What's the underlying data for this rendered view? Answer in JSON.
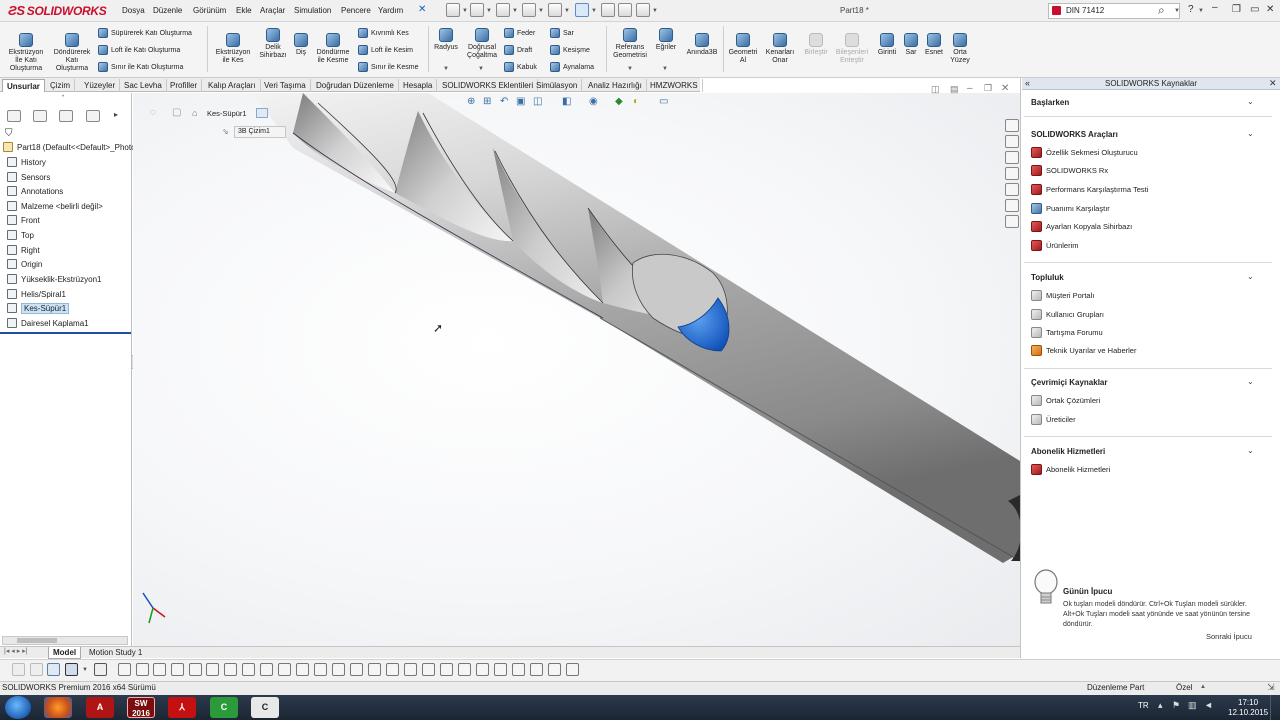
{
  "app": {
    "logo_text": "SOLIDWORKS",
    "doc_title": "Part18 *",
    "search_value": "DIN 71412"
  },
  "menu": [
    "Dosya",
    "Düzenle",
    "Görünüm",
    "Ekle",
    "Araçlar",
    "Simulation",
    "Pencere",
    "Yardım"
  ],
  "command_manager": {
    "big_buttons": [
      {
        "label": "Ekstrüzyon\nİle Katı\nOluşturma"
      },
      {
        "label": "Döndürerek\nKatı\nOluşturma"
      },
      {
        "label": "Ekstrüzyon\nile Kes"
      },
      {
        "label": "Delik\nSihirbazı"
      },
      {
        "label": "Diş"
      },
      {
        "label": "Döndürme\nile Kesme"
      },
      {
        "label": "Radyus"
      },
      {
        "label": "Doğrusal\nÇoğaltma"
      },
      {
        "label": "Referans\nGeometrisi"
      },
      {
        "label": "Eğriler"
      },
      {
        "label": "Anında3B"
      },
      {
        "label": "Geometri\nAl"
      },
      {
        "label": "Kenarları\nOnar"
      },
      {
        "label": "Birleştir"
      },
      {
        "label": "Bileşenleri\nEnteştir"
      },
      {
        "label": "Girinti"
      },
      {
        "label": "Sar"
      },
      {
        "label": "Esnet"
      },
      {
        "label": "Orta\nYüzey"
      }
    ],
    "sweep_group": [
      "Süpürerek Katı Oluşturma",
      "Loft ile Katı Oluşturma",
      "Sınır ile Katı Oluşturma"
    ],
    "cut_group": [
      "Kıvrımlı Kes",
      "Loft ile Kesim",
      "Sınır ile Kesme"
    ],
    "feature_group_a": [
      "Feder",
      "Draft",
      "Kabuk"
    ],
    "feature_group_b": [
      "Sar",
      "Kesişme",
      "Aynalama"
    ]
  },
  "tabs": [
    "Unsurlar",
    "Çizim",
    "Yüzeyler",
    "Sac Levha",
    "Profiller",
    "Kalıp Araçları",
    "Veri Taşıma",
    "Doğrudan Düzenleme",
    "Hesapla",
    "SOLIDWORKS Eklentileri",
    "Simülasyon",
    "Analiz Hazırlığı",
    "HMZWORKS"
  ],
  "feature_tree": {
    "root": "Part18  (Default<<Default>_PhotoWorks",
    "items": [
      {
        "label": "History"
      },
      {
        "label": "Sensors"
      },
      {
        "label": "Annotations"
      },
      {
        "label": "Malzeme <belirli değil>"
      },
      {
        "label": "Front"
      },
      {
        "label": "Top"
      },
      {
        "label": "Right"
      },
      {
        "label": "Origin"
      },
      {
        "label": "Yükseklik-Ekstrüzyon1"
      },
      {
        "label": "Helis/Spiral1"
      },
      {
        "label": "Kes-Süpür1",
        "selected": true
      },
      {
        "label": "Dairesel Kaplama1"
      }
    ]
  },
  "viewport": {
    "breadcrumb_label": "Kes-Süpür1",
    "breadcrumb_sub": "3B Çizim1"
  },
  "taskpane": {
    "header": "SOLIDWORKS Kaynaklar",
    "sections": [
      {
        "title": "Başlarken",
        "links": []
      },
      {
        "title": "SOLIDWORKS Araçları",
        "links": [
          "Özellik Sekmesi Oluşturucu",
          "SOLIDWORKS Rx",
          "Performans Karşılaştırma Testi",
          "Puanımı Karşılaştır",
          "Ayarları Kopyala Sihirbazı",
          "Ürünlerim"
        ]
      },
      {
        "title": "Topluluk",
        "links": [
          "Müşteri Portalı",
          "Kullanıcı Grupları",
          "Tartışma Forumu",
          "Teknik Uyarılar ve Haberler"
        ]
      },
      {
        "title": "Çevrimiçi Kaynaklar",
        "links": [
          "Ortak Çözümleri",
          "Üreticiler"
        ]
      },
      {
        "title": "Abonelik Hizmetleri",
        "links": [
          "Abonelik Hizmetleri"
        ]
      }
    ],
    "tip": {
      "title": "Günün İpucu",
      "text": "Ok tuşları modeli döndürür. Ctrl+Ok Tuşları modeli sürükler. Alt+Ok Tuşları modeli saat yönünde ve saat yönünün tersine döndürür.",
      "next": "Sonraki İpucu"
    }
  },
  "bottom_tabs": [
    "Model",
    "Motion Study 1"
  ],
  "status": {
    "left": "SOLIDWORKS Premium 2016 x64 Sürümü",
    "mode": "Düzenleme Part",
    "units": "Özel"
  },
  "taskbar": {
    "lang": "TR",
    "time": "17:10",
    "date": "12.10.2015",
    "sw_badge": "2016"
  },
  "colors": {
    "brand_red": "#c8102e",
    "selection_blue": "#1f6fd6",
    "shaft_gray": "#b9b9b9"
  }
}
